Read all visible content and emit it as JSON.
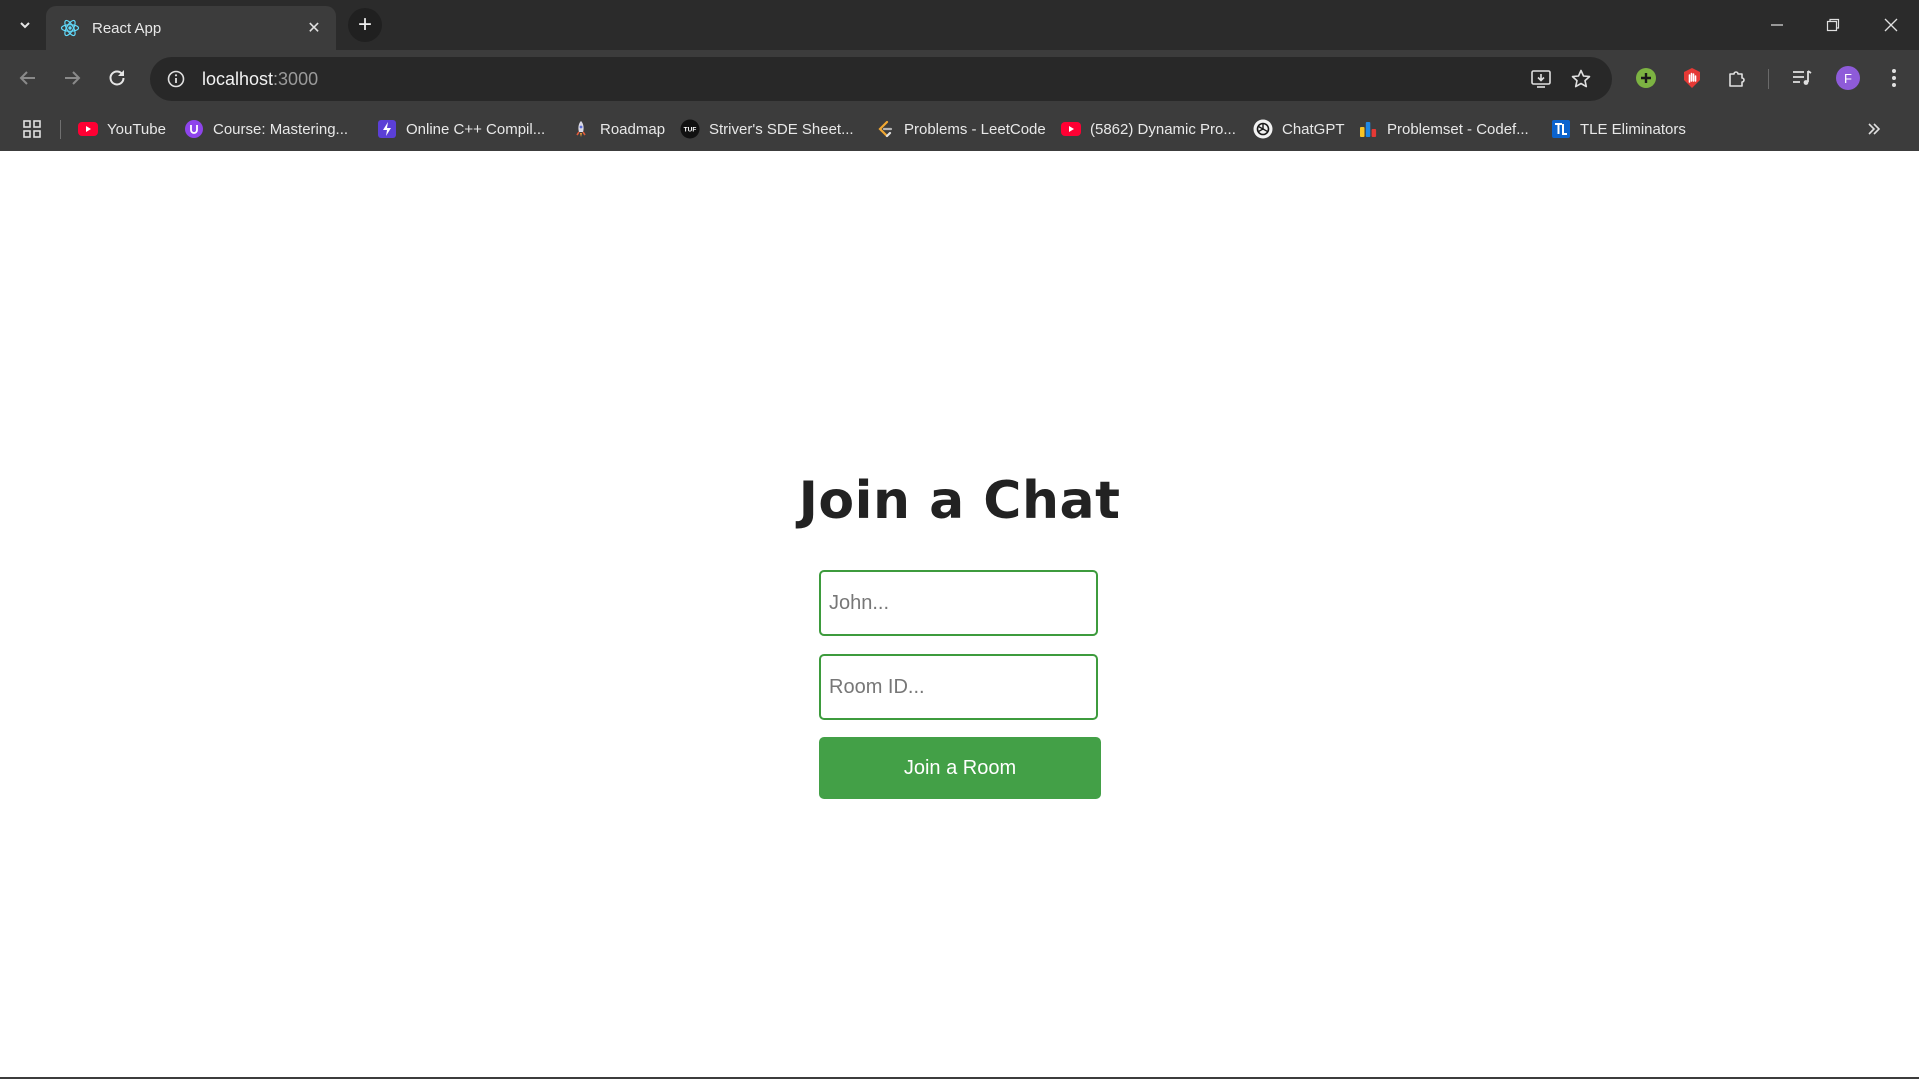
{
  "browser": {
    "tab": {
      "title": "React App",
      "favicon": "react-icon"
    },
    "address_bar": {
      "host": "localhost",
      "port": ":3000"
    },
    "profile_initial": "F",
    "accent_colors": {
      "profile": "#8e5bd9",
      "extension_green": "#7cb342",
      "extension_red": "#e53935"
    },
    "bookmarks": [
      {
        "label": "YouTube",
        "icon": "youtube-icon"
      },
      {
        "label": "Course: Mastering...",
        "icon": "course-icon"
      },
      {
        "label": "Online C++ Compil...",
        "icon": "bolt-icon"
      },
      {
        "label": "Roadmap",
        "icon": "rocket-icon"
      },
      {
        "label": "Striver's SDE Sheet...",
        "icon": "tuf-icon"
      },
      {
        "label": "Problems - LeetCode",
        "icon": "leetcode-icon"
      },
      {
        "label": "(5862) Dynamic Pro...",
        "icon": "youtube-icon"
      },
      {
        "label": "ChatGPT",
        "icon": "chatgpt-icon"
      },
      {
        "label": "Problemset - Codef...",
        "icon": "codeforces-icon"
      },
      {
        "label": "TLE Eliminators",
        "icon": "tle-icon"
      }
    ]
  },
  "page": {
    "title": "Join a Chat",
    "name_input": {
      "placeholder": "John...",
      "value": ""
    },
    "room_input": {
      "placeholder": "Room ID...",
      "value": ""
    },
    "join_button_label": "Join a Room",
    "accent_color": "#43a047"
  }
}
